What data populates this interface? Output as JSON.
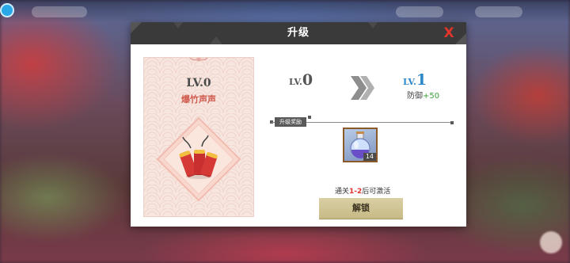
{
  "dialog": {
    "title": "升级",
    "close_label": "X"
  },
  "item_card": {
    "level": "LV.0",
    "name": "爆竹声声",
    "icon": "firecracker-icon"
  },
  "upgrade": {
    "from_prefix": "LV.",
    "from_value": "0",
    "to_prefix": "LV.",
    "to_value": "1",
    "stat_name": "防御",
    "stat_bonus": "+50",
    "arrow_icon": "double-chevron-right-icon"
  },
  "reward": {
    "section_label": "升级奖励",
    "item_icon": "potion-bottle-icon",
    "item_count": "14"
  },
  "unlock": {
    "hint_prefix": "通关",
    "hint_stage": "1-2",
    "hint_suffix": "后可激活",
    "button_label": "解锁"
  },
  "colors": {
    "header_bg": "#3a3a3a",
    "close_red": "#e0352b",
    "level_blue": "#2b87c9",
    "bonus_green": "#3aa23a",
    "button_gold": "#d9cfa4"
  }
}
